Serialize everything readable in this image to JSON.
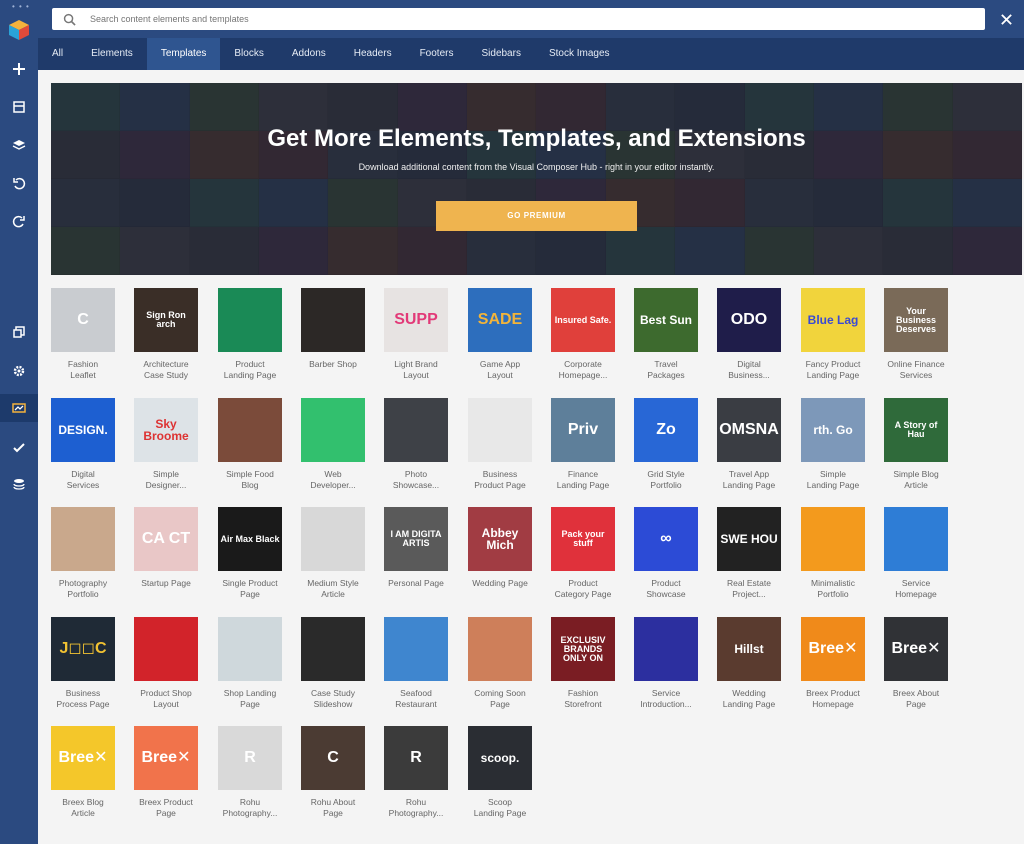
{
  "search": {
    "placeholder": "Search content elements and templates"
  },
  "tabs": [
    {
      "label": "All"
    },
    {
      "label": "Elements"
    },
    {
      "label": "Templates",
      "active": true
    },
    {
      "label": "Blocks"
    },
    {
      "label": "Addons"
    },
    {
      "label": "Headers"
    },
    {
      "label": "Footers"
    },
    {
      "label": "Sidebars"
    },
    {
      "label": "Stock Images"
    }
  ],
  "rail": {
    "icons": [
      "plus-icon",
      "layout-icon",
      "layers-icon",
      "undo-icon",
      "redo-icon",
      "copy-icon",
      "gear-icon",
      "hub-icon",
      "check-icon",
      "stack-icon"
    ]
  },
  "banner": {
    "title": "Get More Elements, Templates, and Extensions",
    "subtitle": "Download additional content from the Visual Composer Hub - right in your editor instantly.",
    "button": "GO PREMIUM"
  },
  "templates": [
    {
      "l1": "Fashion",
      "l2": "Leaflet",
      "bg": "#c9ccd0",
      "fg": "#fff",
      "text": "C"
    },
    {
      "l1": "Architecture",
      "l2": "Case Study",
      "bg": "#3a2e27",
      "fg": "#fff",
      "text": "Sign Ron arch"
    },
    {
      "l1": "Product",
      "l2": "Landing Page",
      "bg": "#1a8a56",
      "fg": "#fff",
      "text": ""
    },
    {
      "l1": "Barber Shop",
      "l2": "",
      "bg": "#2c2826",
      "fg": "#fff",
      "text": ""
    },
    {
      "l1": "Light Brand",
      "l2": "Layout",
      "bg": "#e7e3e2",
      "fg": "#e23a78",
      "text": "SUPP"
    },
    {
      "l1": "Game App",
      "l2": "Layout",
      "bg": "#2d6ebd",
      "fg": "#f2b43a",
      "text": "SADE"
    },
    {
      "l1": "Corporate",
      "l2": "Homepage...",
      "bg": "#e0403b",
      "fg": "#fff",
      "text": "Insured Safe."
    },
    {
      "l1": "Travel",
      "l2": "Packages",
      "bg": "#3d6a2e",
      "fg": "#fff",
      "text": "Best Sun"
    },
    {
      "l1": "Digital",
      "l2": "Business...",
      "bg": "#1f1d4a",
      "fg": "#fff",
      "text": "ODO"
    },
    {
      "l1": "Fancy Product",
      "l2": "Landing Page",
      "bg": "#f1d43c",
      "fg": "#3a4ad4",
      "text": "Blue Lag"
    },
    {
      "l1": "Online Finance",
      "l2": "Services",
      "bg": "#7a6a58",
      "fg": "#fff",
      "text": "Your Business Deserves"
    },
    {
      "l1": "Digital",
      "l2": "Services",
      "bg": "#1d5fd1",
      "fg": "#fff",
      "text": "DESIGN."
    },
    {
      "l1": "Simple",
      "l2": "Designer...",
      "bg": "#dde3e7",
      "fg": "#d33",
      "text": "Sky Broome"
    },
    {
      "l1": "Simple Food",
      "l2": "Blog",
      "bg": "#7b4b3a",
      "fg": "#fff",
      "text": ""
    },
    {
      "l1": "Web",
      "l2": "Developer...",
      "bg": "#32c06e",
      "fg": "#fff",
      "text": ""
    },
    {
      "l1": "Photo",
      "l2": "Showcase...",
      "bg": "#3e4147",
      "fg": "#fff",
      "text": ""
    },
    {
      "l1": "Business",
      "l2": "Product Page",
      "bg": "#e8e8e8",
      "fg": "#999",
      "text": ""
    },
    {
      "l1": "Finance",
      "l2": "Landing Page",
      "bg": "#5e7f9a",
      "fg": "#fff",
      "text": "Priv"
    },
    {
      "l1": "Grid Style",
      "l2": "Portfolio",
      "bg": "#2867d6",
      "fg": "#fff",
      "text": "Zo"
    },
    {
      "l1": "Travel App",
      "l2": "Landing Page",
      "bg": "#3a3d43",
      "fg": "#fff",
      "text": "OMSNA"
    },
    {
      "l1": "Simple",
      "l2": "Landing Page",
      "bg": "#7d98b9",
      "fg": "#fff",
      "text": "rth. Go"
    },
    {
      "l1": "Simple Blog",
      "l2": "Article",
      "bg": "#2f6a3a",
      "fg": "#fff",
      "text": "A Story of Hau"
    },
    {
      "l1": "Photography",
      "l2": "Portfolio",
      "bg": "#c9a88c",
      "fg": "#fff",
      "text": ""
    },
    {
      "l1": "Startup Page",
      "l2": "",
      "bg": "#e9c7c7",
      "fg": "#fff",
      "text": "CA CT"
    },
    {
      "l1": "Single Product",
      "l2": "Page",
      "bg": "#1a1a1a",
      "fg": "#fff",
      "text": "Air Max Black"
    },
    {
      "l1": "Medium Style",
      "l2": "Article",
      "bg": "#d8d8d8",
      "fg": "#333",
      "text": ""
    },
    {
      "l1": "Personal Page",
      "l2": "",
      "bg": "#5a5a5a",
      "fg": "#fff",
      "text": "I AM DIGITA ARTIS"
    },
    {
      "l1": "Wedding Page",
      "l2": "",
      "bg": "#a13c43",
      "fg": "#fff",
      "text": "Abbey Mich"
    },
    {
      "l1": "Product",
      "l2": "Category Page",
      "bg": "#e0313b",
      "fg": "#fff",
      "text": "Pack your stuff"
    },
    {
      "l1": "Product",
      "l2": "Showcase",
      "bg": "#2c4bd6",
      "fg": "#fff",
      "text": "∞"
    },
    {
      "l1": "Real Estate",
      "l2": "Project...",
      "bg": "#222",
      "fg": "#fff",
      "text": "SWE HOU"
    },
    {
      "l1": "Minimalistic",
      "l2": "Portfolio",
      "bg": "#f39a1d",
      "fg": "#fff",
      "text": ""
    },
    {
      "l1": "Service",
      "l2": "Homepage",
      "bg": "#2e7dd6",
      "fg": "#fff",
      "text": ""
    },
    {
      "l1": "Business",
      "l2": "Process Page",
      "bg": "#1f2a36",
      "fg": "#f1c232",
      "text": "J◻◻C"
    },
    {
      "l1": "Product Shop",
      "l2": "Layout",
      "bg": "#d2232a",
      "fg": "#fff",
      "text": ""
    },
    {
      "l1": "Shop Landing",
      "l2": "Page",
      "bg": "#cfd8dc",
      "fg": "#fff",
      "text": ""
    },
    {
      "l1": "Case Study",
      "l2": "Slideshow",
      "bg": "#2a2a2a",
      "fg": "#fff",
      "text": ""
    },
    {
      "l1": "Seafood",
      "l2": "Restaurant",
      "bg": "#3f86cf",
      "fg": "#fff",
      "text": ""
    },
    {
      "l1": "Coming Soon",
      "l2": "Page",
      "bg": "#ce7f5a",
      "fg": "#fff",
      "text": ""
    },
    {
      "l1": "Fashion",
      "l2": "Storefront",
      "bg": "#7a1d23",
      "fg": "#fff",
      "text": "EXCLUSIV BRANDS ONLY ON"
    },
    {
      "l1": "Service",
      "l2": "Introduction...",
      "bg": "#2c2f9f",
      "fg": "#f8c534",
      "text": ""
    },
    {
      "l1": "Wedding",
      "l2": "Landing Page",
      "bg": "#5a3b2f",
      "fg": "#fff",
      "text": "Hillst"
    },
    {
      "l1": "Breex Product",
      "l2": "Homepage",
      "bg": "#f08a1a",
      "fg": "#fff",
      "text": "Bree✕"
    },
    {
      "l1": "Breex About",
      "l2": "Page",
      "bg": "#303236",
      "fg": "#fff",
      "text": "Bree✕"
    },
    {
      "l1": "Breex Blog",
      "l2": "Article",
      "bg": "#f4c72a",
      "fg": "#fff",
      "text": "Bree✕"
    },
    {
      "l1": "Breex Product",
      "l2": "Page",
      "bg": "#f1734b",
      "fg": "#fff",
      "text": "Bree✕"
    },
    {
      "l1": "Rohu",
      "l2": "Photography...",
      "bg": "#d9d9d9",
      "fg": "#fff",
      "text": "R"
    },
    {
      "l1": "Rohu About",
      "l2": "Page",
      "bg": "#4b3b33",
      "fg": "#fff",
      "text": "C"
    },
    {
      "l1": "Rohu",
      "l2": "Photography...",
      "bg": "#3b3b3b",
      "fg": "#fff",
      "text": "R"
    },
    {
      "l1": "Scoop",
      "l2": "Landing Page",
      "bg": "#2a2d33",
      "fg": "#fff",
      "text": "scoop."
    }
  ]
}
